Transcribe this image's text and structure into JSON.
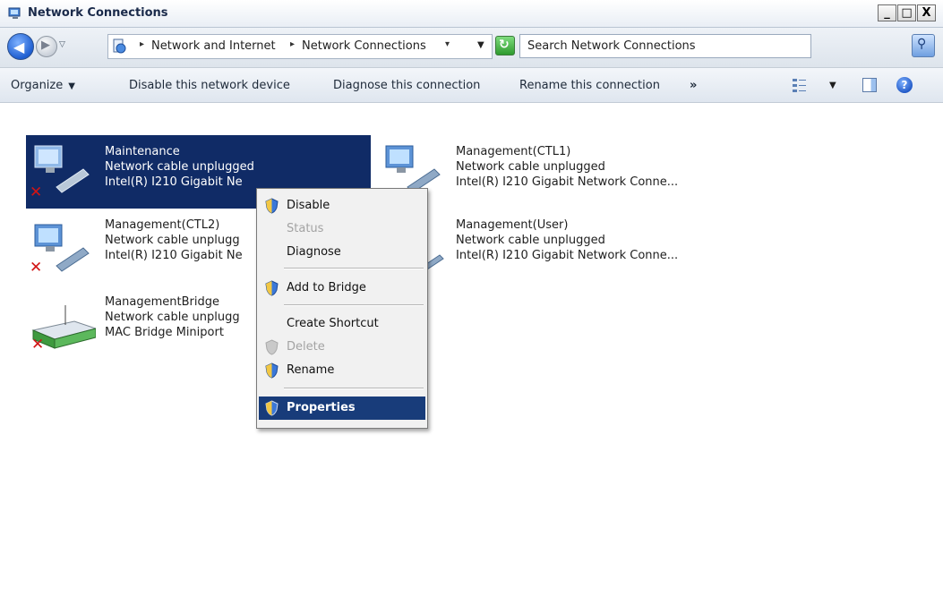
{
  "window": {
    "title": "Network Connections",
    "buttons": {
      "minimize": "_",
      "maximize": "□",
      "close": "X"
    }
  },
  "address": {
    "crumbs": [
      "Network and Internet",
      "Network Connections"
    ],
    "search_placeholder": "Search Network Connections"
  },
  "commandbar": {
    "organize": "Organize",
    "disable": "Disable this network device",
    "diagnose": "Diagnose this connection",
    "rename": "Rename this connection",
    "more": "»"
  },
  "connections": [
    {
      "name": "Maintenance",
      "status": "Network cable unplugged",
      "device": "Intel(R) I210 Gigabit Ne",
      "selected": true,
      "disconnected": true
    },
    {
      "name": "Management(CTL1)",
      "status": "Network cable unplugged",
      "device": "Intel(R) I210 Gigabit Network Conne...",
      "selected": false,
      "disconnected": false
    },
    {
      "name": "Management(CTL2)",
      "status": "Network cable unplugg",
      "device": "Intel(R) I210 Gigabit Ne",
      "selected": false,
      "disconnected": true
    },
    {
      "name": "Management(User)",
      "status": "Network cable unplugged",
      "device": "Intel(R) I210 Gigabit Network Conne...",
      "selected": false,
      "disconnected": false
    },
    {
      "name": "ManagementBridge",
      "status": "Network cable unplugg",
      "device": "MAC Bridge Miniport",
      "selected": false,
      "disconnected": true
    }
  ],
  "context_menu": {
    "items": [
      {
        "label": "Disable",
        "shield": true,
        "disabled": false
      },
      {
        "label": "Status",
        "shield": false,
        "disabled": true
      },
      {
        "label": "Diagnose",
        "shield": false,
        "disabled": false
      },
      {
        "label": "Add to Bridge",
        "shield": true,
        "disabled": false
      },
      {
        "label": "Create Shortcut",
        "shield": false,
        "disabled": false
      },
      {
        "label": "Delete",
        "shield": true,
        "disabled": true
      },
      {
        "label": "Rename",
        "shield": true,
        "disabled": false
      },
      {
        "label": "Properties",
        "shield": true,
        "disabled": false,
        "highlighted": true
      }
    ]
  },
  "colors": {
    "selection": "#102b66",
    "menu_highlight": "#183c7a",
    "error_x": "#d11414"
  }
}
